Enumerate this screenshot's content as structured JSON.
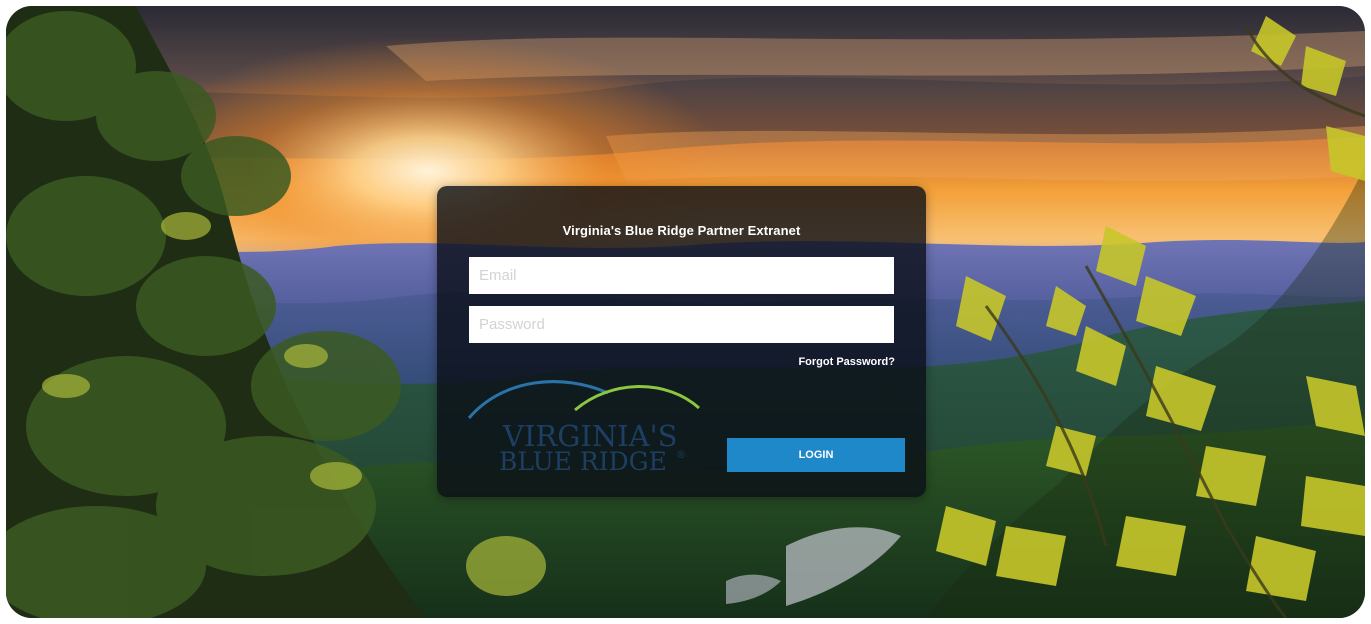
{
  "panel": {
    "title": "Virginia's Blue Ridge Partner Extranet",
    "email_placeholder": "Email",
    "password_placeholder": "Password",
    "forgot_label": "Forgot Password?",
    "login_label": "LOGIN"
  },
  "logo": {
    "line1": "VIRGINIA'S",
    "line2": "BLUE RIDGE",
    "mark": "®"
  },
  "colors": {
    "panel_bg": "#0a0e16",
    "login_button": "#1e88c9",
    "logo_text": "#1d3f63",
    "logo_arc_blue": "#2a73a8",
    "logo_arc_green": "#8dc63f"
  }
}
